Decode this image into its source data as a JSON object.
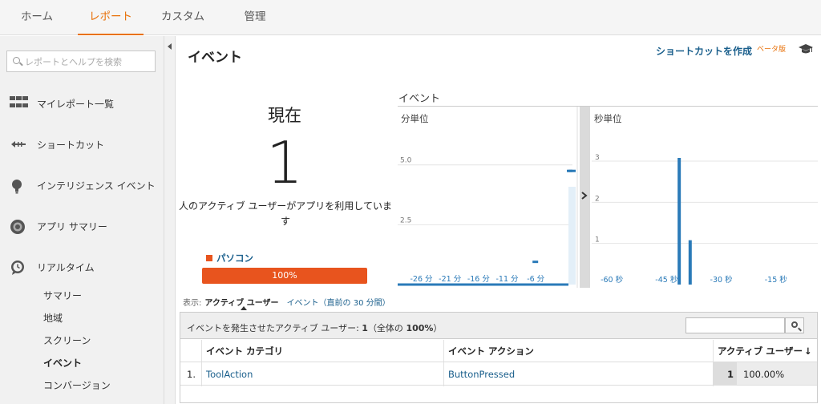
{
  "topnav": {
    "tabs": [
      {
        "label": "ホーム",
        "active": false
      },
      {
        "label": "レポート",
        "active": true
      },
      {
        "label": "カスタム",
        "active": false
      },
      {
        "label": "管理",
        "active": false
      }
    ]
  },
  "sidebar": {
    "search_placeholder": "レポートとヘルプを検索",
    "items": [
      {
        "label": "マイレポート一覧",
        "icon": "grid-icon"
      },
      {
        "label": "ショートカット",
        "icon": "shortcut-arrow-icon"
      },
      {
        "label": "インテリジェンス イベント",
        "icon": "lightbulb-icon"
      },
      {
        "label": "アプリ サマリー",
        "icon": "circle-target-icon"
      },
      {
        "label": "リアルタイム",
        "icon": "clock-bubble-icon"
      }
    ],
    "subitems": [
      {
        "label": "サマリー",
        "active": false
      },
      {
        "label": "地域",
        "active": false
      },
      {
        "label": "スクリーン",
        "active": false
      },
      {
        "label": "イベント",
        "active": true
      },
      {
        "label": "コンバージョン",
        "active": false
      }
    ]
  },
  "main": {
    "title": "イベント",
    "shortcut_label": "ショートカットを作成",
    "beta_label": "ベータ版",
    "now": {
      "label": "現在",
      "value": "1",
      "description": "人のアクティブ ユーザーがアプリを利用しています"
    },
    "device_legend": "パソコン",
    "device_bar": "100%",
    "accent_color": "#e8541e",
    "link_color": "#1a5f8c"
  },
  "chart_data": [
    {
      "type": "bar",
      "title": "イベント",
      "subtitle": "分単位",
      "x_ticks": [
        "-26 分",
        "-21 分",
        "-16 分",
        "-11 分",
        "-6 分"
      ],
      "y_ticks": [
        "2.5",
        "5.0"
      ],
      "x": [
        -30,
        -29,
        -28,
        -27,
        -26,
        -25,
        -24,
        -23,
        -22,
        -21,
        -20,
        -19,
        -18,
        -17,
        -16,
        -15,
        -14,
        -13,
        -12,
        -11,
        -10,
        -9,
        -8,
        -7,
        -6,
        -5,
        -4,
        -3,
        -2,
        -1,
        0
      ],
      "values": [
        0,
        0,
        0,
        0,
        0,
        0,
        0,
        0,
        0,
        0,
        0,
        0,
        0,
        0,
        0,
        0,
        0,
        0,
        0,
        0,
        0,
        0,
        0,
        0,
        1,
        0,
        0,
        0,
        0,
        0,
        4.8
      ],
      "ylim": [
        0,
        6.7
      ],
      "color": "#2a7ab8"
    },
    {
      "type": "bar",
      "subtitle": "秒単位",
      "x_ticks": [
        "-60 秒",
        "-45 秒",
        "-30 秒",
        "-15 秒"
      ],
      "y_ticks": [
        "1",
        "2",
        "3"
      ],
      "x": [
        -60,
        -55,
        -50,
        -45,
        -40,
        -38,
        -35,
        -30,
        -25,
        -20,
        -15,
        -10,
        -5
      ],
      "values": [
        0,
        0,
        0,
        0,
        0,
        3.0,
        1.0,
        0,
        0,
        0,
        0,
        0,
        0
      ],
      "ylim": [
        0,
        3.3
      ],
      "color": "#2a7ab8"
    }
  ],
  "table": {
    "show_label": "表示:",
    "show_current": "アクティブ ユーザー",
    "show_alt": "イベント（直前の 30 分間）",
    "summary_prefix": "イベントを発生させたアクティブ ユーザー: ",
    "summary_value": "1",
    "summary_suffix_pre": "（全体の ",
    "summary_pct": "100%",
    "summary_suffix_post": "）",
    "columns": [
      "イベント カテゴリ",
      "イベント アクション",
      "アクティブ ユーザー"
    ],
    "rows": [
      {
        "index": "1.",
        "category": "ToolAction",
        "action": "ButtonPressed",
        "users": "1",
        "percent": "100.00%"
      }
    ]
  }
}
